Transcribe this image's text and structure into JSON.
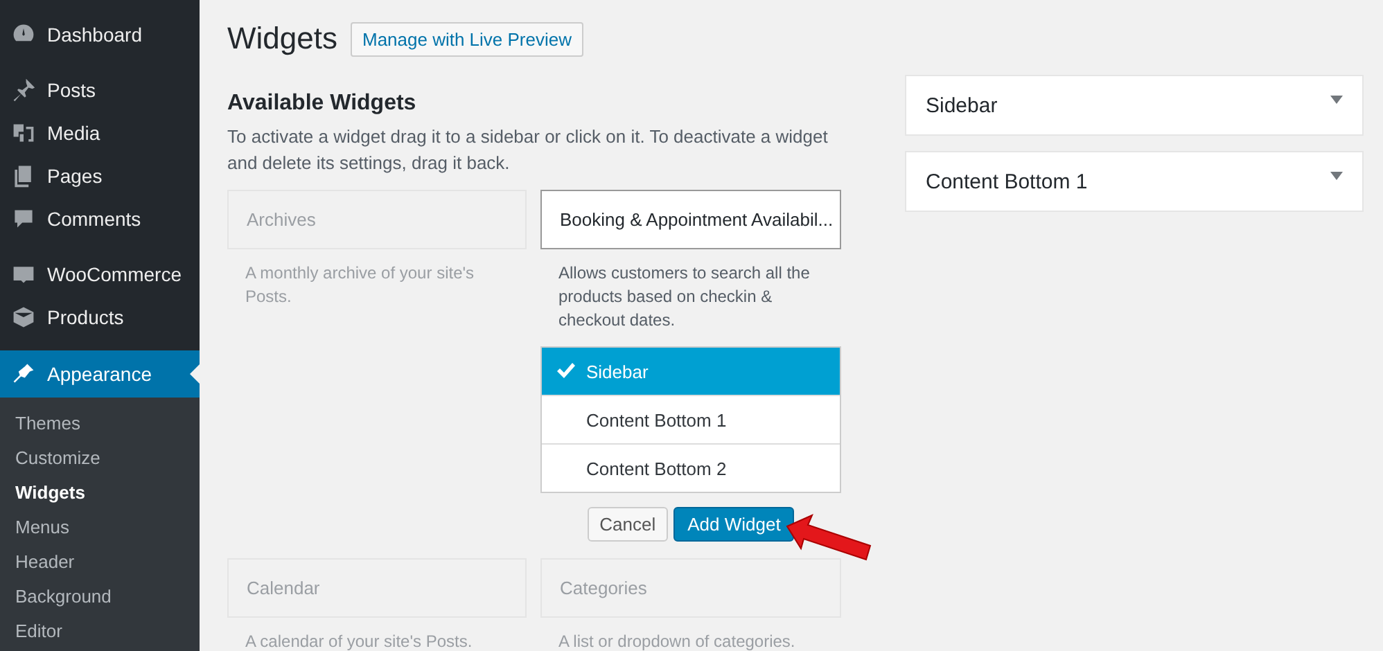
{
  "admin_menu": {
    "groups": [
      {
        "items": [
          {
            "label": "Dashboard",
            "selected": false
          }
        ]
      },
      {
        "items": [
          {
            "label": "Posts",
            "selected": false
          },
          {
            "label": "Media",
            "selected": false
          },
          {
            "label": "Pages",
            "selected": false
          },
          {
            "label": "Comments",
            "selected": false
          }
        ]
      },
      {
        "items": [
          {
            "label": "WooCommerce",
            "selected": false
          },
          {
            "label": "Products",
            "selected": false
          }
        ]
      },
      {
        "items": [
          {
            "label": "Appearance",
            "selected": true
          }
        ]
      }
    ],
    "submenu": [
      {
        "label": "Themes",
        "selected": false
      },
      {
        "label": "Customize",
        "selected": false
      },
      {
        "label": "Widgets",
        "selected": true
      },
      {
        "label": "Menus",
        "selected": false
      },
      {
        "label": "Header",
        "selected": false
      },
      {
        "label": "Background",
        "selected": false
      },
      {
        "label": "Editor",
        "selected": false
      }
    ]
  },
  "page": {
    "title": "Widgets",
    "action_button": "Manage with Live Preview"
  },
  "available_widgets": {
    "heading": "Available Widgets",
    "description": "To activate a widget drag it to a sidebar or click on it. To deactivate a widget and delete its settings, drag it back.",
    "widgets": [
      {
        "title": "Archives",
        "description": "A monthly archive of your site's Posts.",
        "dimmed": true,
        "expanded": false
      },
      {
        "title": "Booking & Appointment Availabil...",
        "description": "Allows customers to search all the products based on checkin & checkout dates.",
        "dimmed": false,
        "expanded": true
      },
      {
        "title": "Calendar",
        "description": "A calendar of your site's Posts.",
        "dimmed": true,
        "expanded": false
      },
      {
        "title": "Categories",
        "description": "A list or dropdown of categories.",
        "dimmed": true,
        "expanded": false
      }
    ],
    "chooser": {
      "options": [
        {
          "label": "Sidebar",
          "selected": true
        },
        {
          "label": "Content Bottom 1",
          "selected": false
        },
        {
          "label": "Content Bottom 2",
          "selected": false
        }
      ],
      "cancel": "Cancel",
      "add": "Add Widget"
    }
  },
  "sidebars": [
    {
      "title": "Sidebar",
      "expanded": false
    },
    {
      "title": "Content Bottom 1",
      "expanded": false
    }
  ]
}
